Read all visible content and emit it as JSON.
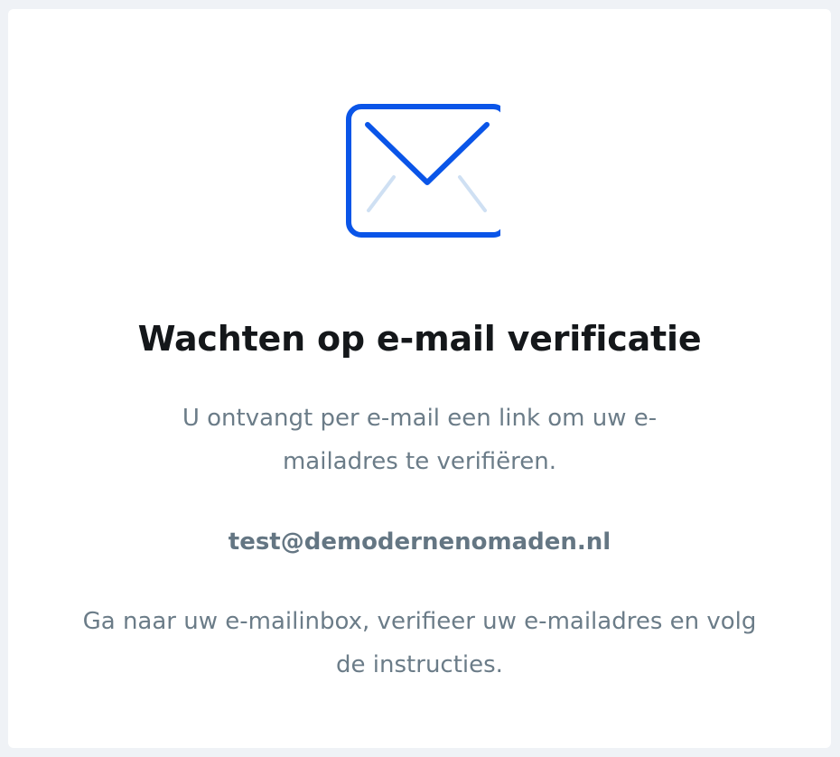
{
  "verification": {
    "icon": "envelope-icon",
    "title": "Wachten op e-mail verificatie",
    "description": "U ontvangt per e-mail een link om uw e-mailadres te verifiëren.",
    "email": "test@demodernenomaden.nl",
    "instructions": "Ga naar uw e-mailinbox, verifieer uw e-mailadres en volg de instructies."
  },
  "colors": {
    "accent": "#0a55e8",
    "accent_light": "#cfe0f3",
    "title": "#14171a",
    "text": "#6b7c88",
    "background": "#eff2f6",
    "card": "#ffffff"
  }
}
